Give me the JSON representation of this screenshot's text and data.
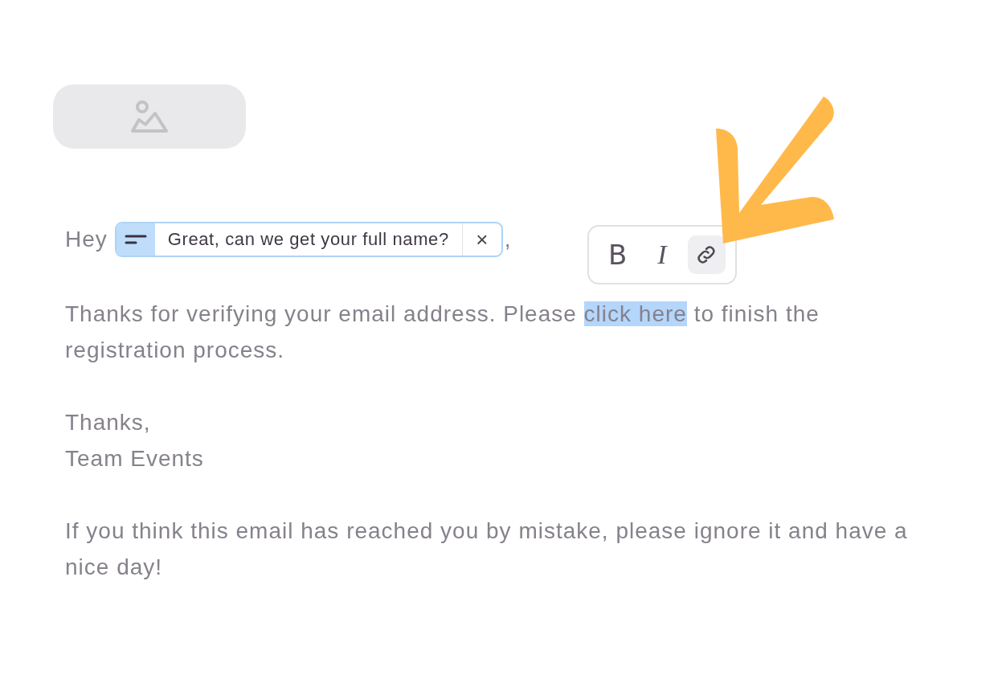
{
  "greeting": {
    "before": "Hey",
    "field": {
      "value": "Great, can we get your full name?",
      "close": "×"
    },
    "after": ","
  },
  "toolbar": [
    {
      "kind": "bold",
      "label": "B",
      "selected": false
    },
    {
      "kind": "italic",
      "label": "I",
      "selected": false
    },
    {
      "kind": "link",
      "selected": true
    }
  ],
  "paragraphs": [
    {
      "parts": [
        {
          "text": "Thanks for verifying your email address. Please ",
          "selected": false
        },
        {
          "text": "click here",
          "selected": true
        },
        {
          "text": " to finish the registration process.",
          "selected": false
        }
      ]
    },
    {
      "lines": [
        "Thanks,",
        "Team Events"
      ]
    },
    {
      "parts": [
        {
          "text": "If you think this email has reached you by mistake, please ignore it and have a nice day!",
          "selected": false
        }
      ]
    }
  ]
}
